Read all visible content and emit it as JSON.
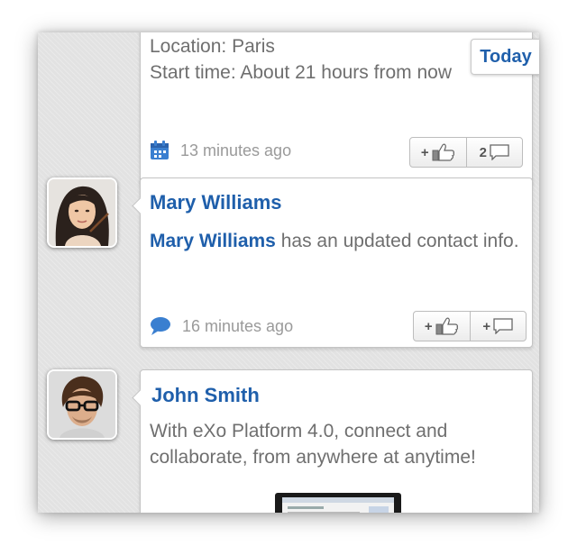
{
  "sticky_label": "Today",
  "activities": [
    {
      "lines": [
        "Location: Paris",
        "Start time: About 21 hours from now"
      ],
      "time": "13 minutes ago",
      "meta_icon": "calendar-icon",
      "like_label": "+",
      "comment_label": "2"
    },
    {
      "author": "Mary Williams",
      "body_name": "Mary Williams",
      "body_rest": " has an updated contact info.",
      "time": "16 minutes ago",
      "meta_icon": "speech-bubble-icon",
      "like_label": "+",
      "comment_label": "+"
    },
    {
      "author": "John Smith",
      "body": "With eXo Platform 4.0, connect and collaborate, from anywhere at anytime!",
      "attachment": "screenshot-thumbnail"
    }
  ],
  "colors": {
    "link": "#1f5fab",
    "text": "#6f6f6f",
    "meta": "#9a9a9a",
    "background": "#e2e2e2"
  }
}
